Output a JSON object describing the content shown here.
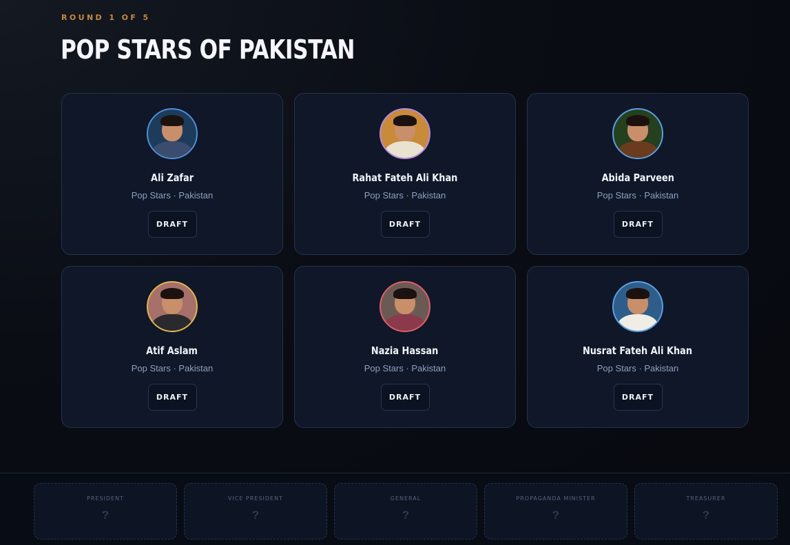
{
  "header": {
    "round_label": "ROUND 1 OF 5",
    "title": "POP STARS OF PAKISTAN"
  },
  "cards": [
    {
      "name": "Ali Zafar",
      "meta": "Pop Stars · Pakistan",
      "button": "DRAFT",
      "ring": "#4f8fd8",
      "bg": "#1d3b5a",
      "shirt": "#3b4d6e"
    },
    {
      "name": "Rahat Fateh Ali Khan",
      "meta": "Pop Stars · Pakistan",
      "button": "DRAFT",
      "ring": "#b58ae0",
      "bg": "#c98a3a",
      "shirt": "#e9e2d0"
    },
    {
      "name": "Abida Parveen",
      "meta": "Pop Stars · Pakistan",
      "button": "DRAFT",
      "ring": "#5aa0e0",
      "bg": "#24401f",
      "shirt": "#6b3b1e"
    },
    {
      "name": "Atif Aslam",
      "meta": "Pop Stars · Pakistan",
      "button": "DRAFT",
      "ring": "#e0b650",
      "bg": "#a7706a",
      "shirt": "#2a2a2e"
    },
    {
      "name": "Nazia Hassan",
      "meta": "Pop Stars · Pakistan",
      "button": "DRAFT",
      "ring": "#e0606a",
      "bg": "#6b5a54",
      "shirt": "#8a3a4a"
    },
    {
      "name": "Nusrat Fateh Ali Khan",
      "meta": "Pop Stars · Pakistan",
      "button": "DRAFT",
      "ring": "#5aa0e0",
      "bg": "#2f5d8a",
      "shirt": "#f0ede6"
    }
  ],
  "cabinet": {
    "slots": [
      {
        "label": "PRESIDENT",
        "value": "?"
      },
      {
        "label": "VICE PRESIDENT",
        "value": "?"
      },
      {
        "label": "GENERAL",
        "value": "?"
      },
      {
        "label": "PROPAGANDA MINISTER",
        "value": "?"
      },
      {
        "label": "TREASURER",
        "value": "?"
      }
    ]
  }
}
